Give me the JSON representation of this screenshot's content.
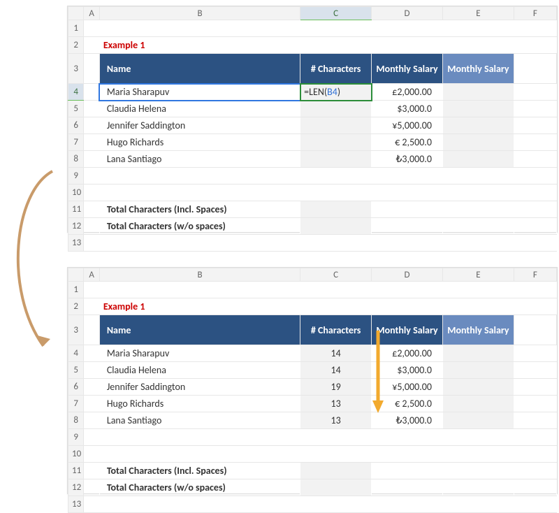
{
  "columns": [
    "",
    "A",
    "B",
    "C",
    "D",
    "E",
    "F"
  ],
  "row_labels": [
    "1",
    "2",
    "3",
    "4",
    "5",
    "6",
    "7",
    "8",
    "9",
    "10",
    "11",
    "12",
    "13"
  ],
  "example_title": "Example 1",
  "headers": {
    "name": "Name",
    "chars": "# Characters",
    "salary1": "Monthly Salary",
    "salary2": "Monthly Salary"
  },
  "names": [
    "Maria Sharapuv",
    "Claudia Helena",
    "Jennifer Saddington",
    "Hugo Richards",
    "Lana Santiago"
  ],
  "salaries": [
    "£2,000.00",
    "$3,000.0",
    "¥5,000.00",
    "€ 2,500.0",
    "₺3,000.0"
  ],
  "formula_text_prefix": "=LEN(",
  "formula_ref": "B4",
  "formula_text_suffix": ")",
  "char_counts": [
    "14",
    "14",
    "19",
    "13",
    "13"
  ],
  "totals": {
    "incl": "Total Characters (Incl. Spaces)",
    "wo": "Total Characters (w/o spaces)"
  }
}
